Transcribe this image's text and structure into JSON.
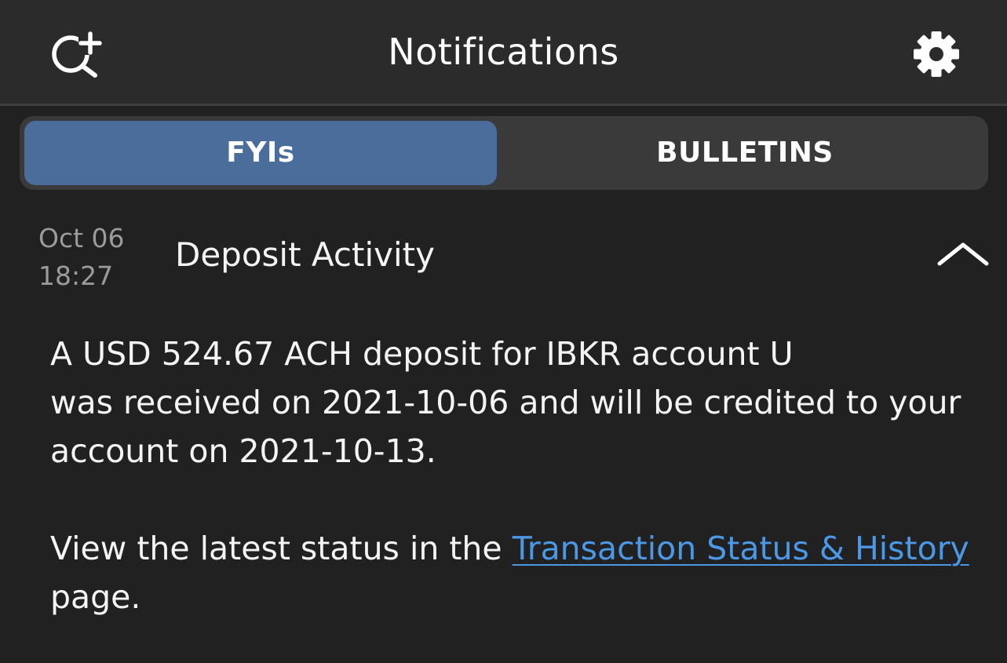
{
  "header": {
    "title": "Notifications",
    "left_icon": "search-add-icon",
    "right_icon": "gear-icon"
  },
  "tabs": [
    {
      "label": "FYIs",
      "selected": true
    },
    {
      "label": "BULLETINS",
      "selected": false
    }
  ],
  "notification": {
    "date": "Oct 06",
    "time": "18:27",
    "title": "Deposit Activity",
    "expand_icon": "chevron-up-icon",
    "body_line1": "A USD 524.67 ACH deposit for IBKR account U",
    "body_line2": "was received on 2021-10-06 and will be credited to your",
    "body_line3": "account on 2021-10-13.",
    "body2_prefix": "View the latest status in the ",
    "body2_link": "Transaction Status & History",
    "body2_suffix": "page."
  },
  "colors": {
    "background": "#212121",
    "header_background": "#2b2b2b",
    "tab_selected": "#4a6d9c",
    "tab_track": "#3a3a3a",
    "link": "#4a98e6",
    "date_text": "#9b9b9b"
  }
}
